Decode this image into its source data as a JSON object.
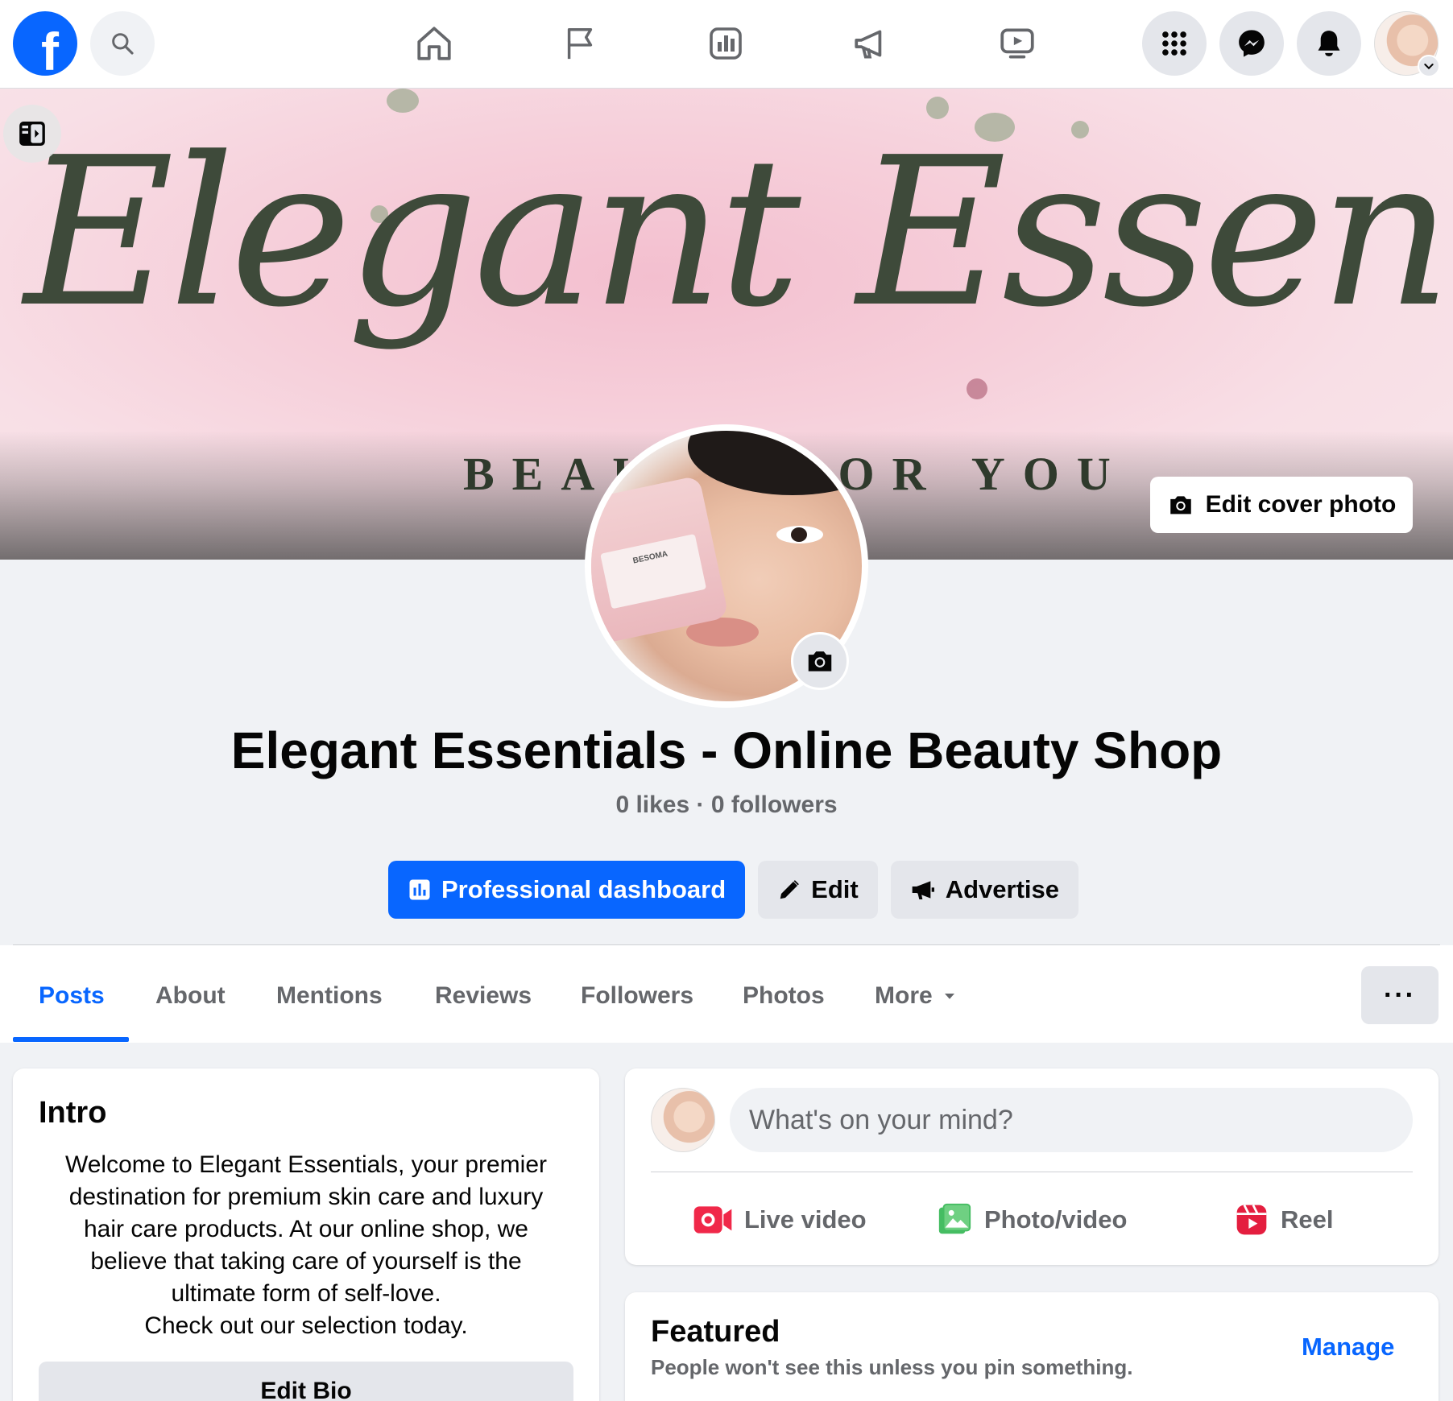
{
  "brand": {
    "logo_letter": "f",
    "color": "#0866ff"
  },
  "topbar": {
    "nav_icons": [
      "home-icon",
      "flag-icon",
      "insights-icon",
      "megaphone-icon",
      "video-icon"
    ],
    "right_icons": [
      "menu-grid-icon",
      "messenger-icon",
      "bell-icon"
    ]
  },
  "cover": {
    "script_text": "Elegant Essentials",
    "tagline": "BEAUTY FOR YOU",
    "edit_label": "Edit cover photo"
  },
  "profile": {
    "jar_label": "BESOMA",
    "name": "Elegant Essentials - Online Beauty Shop",
    "stats": "0 likes · 0 followers"
  },
  "actions": {
    "dashboard": "Professional dashboard",
    "edit": "Edit",
    "advertise": "Advertise"
  },
  "tabs": [
    "Posts",
    "About",
    "Mentions",
    "Reviews",
    "Followers",
    "Photos",
    "More"
  ],
  "more_options": "···",
  "intro": {
    "title": "Intro",
    "bio": "Welcome to Elegant Essentials, your premier\ndestination for premium skin care and luxury\nhair care products. At our online shop, we\nbelieve that taking care of yourself is the\nultimate form of self-love.\nCheck out our selection today.",
    "edit_bio": "Edit Bio"
  },
  "composer": {
    "placeholder": "What's on your mind?",
    "live": "Live video",
    "photo": "Photo/video",
    "reel": "Reel"
  },
  "featured": {
    "title": "Featured",
    "subtitle": "People won't see this unless you pin something.",
    "manage": "Manage"
  }
}
